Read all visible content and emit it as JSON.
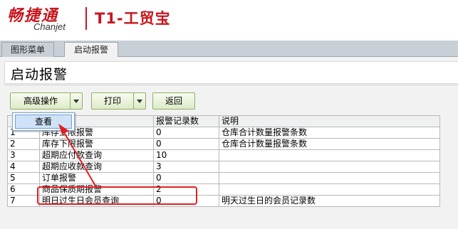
{
  "header": {
    "brand_cn": "畅捷通",
    "brand_en": "Chanjet",
    "product": "T1-工贸宝"
  },
  "tabs": [
    {
      "label": "图形菜单"
    },
    {
      "label": "启动报警"
    }
  ],
  "page": {
    "title": "启动报警"
  },
  "toolbar": {
    "advanced_label": "高级操作",
    "print_label": "打印",
    "back_label": "返回"
  },
  "dropdown": {
    "view_label": "查看"
  },
  "table": {
    "columns": [
      "",
      "项目",
      "报警记录数",
      "说明"
    ],
    "rows": [
      {
        "num": "1",
        "item": "库存上限报警",
        "count": "0",
        "desc": "仓库合计数量报警条数"
      },
      {
        "num": "2",
        "item": "库存下限报警",
        "count": "0",
        "desc": "仓库合计数量报警条数"
      },
      {
        "num": "3",
        "item": "超期应付款查询",
        "count": "10",
        "desc": ""
      },
      {
        "num": "4",
        "item": "超期应收款查询",
        "count": "3",
        "desc": ""
      },
      {
        "num": "5",
        "item": "订单报警",
        "count": "0",
        "desc": ""
      },
      {
        "num": "6",
        "item": "商品保质期报警",
        "count": "2",
        "desc": ""
      },
      {
        "num": "7",
        "item": "明日过生日会员查询",
        "count": "0",
        "desc": "明天过生日的会员记录数"
      }
    ]
  },
  "colors": {
    "brand": "#c8161d",
    "annotation": "#e02020",
    "button_border": "#8fb067"
  }
}
